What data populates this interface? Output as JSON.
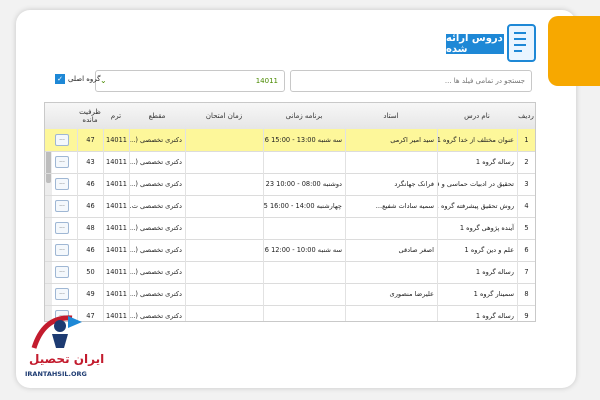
{
  "header": {
    "title": "دروس ارائه شده",
    "icon": "checklist-icon"
  },
  "search": {
    "placeholder": "جستجو در تمامی فیلد ها ..."
  },
  "term_select": {
    "value": "14011"
  },
  "main_group": {
    "label": "گروه اصلی",
    "checked": true
  },
  "table": {
    "headers": {
      "row_no": "ردیف",
      "course": "نام درس",
      "teacher": "استاد",
      "schedule": "برنامه زمانی",
      "exam": "زمان امتحان",
      "level": "مقطع",
      "term": "ترم",
      "capacity": "ظرفیت مانده"
    },
    "rows": [
      {
        "n": "1",
        "course": "عنوان مختلف از خدا گروه 1",
        "teacher": "سید امیر اکرمی",
        "schedule": "سه شنبه 13:00 - 15:00 26 ...",
        "exam": "",
        "level": "دکتری تخصصی (...",
        "term": "14011",
        "capacity": "47",
        "more": "..."
      },
      {
        "n": "2",
        "course": "رساله گروه 1",
        "teacher": "",
        "schedule": "",
        "exam": "",
        "level": "دکتری تخصصی (...",
        "term": "14011",
        "capacity": "43",
        "more": "..."
      },
      {
        "n": "3",
        "course": "تحقیق در ادبیات حماسی و قهرمانی گروه 1",
        "teacher": "فرانک جهانگرد",
        "schedule": "دوشنبه 08:00 - 10:00 23 **",
        "exam": "",
        "level": "دکتری تخصصی (...",
        "term": "14011",
        "capacity": "46",
        "more": "..."
      },
      {
        "n": "4",
        "course": "روش تحقیق پیشرفته گروه 1",
        "teacher": "سمیه سادات شفیع...",
        "schedule": "چهارشنبه 14:00 - 16:00 25 ...",
        "exam": "",
        "level": "دکتری تخصصی ت...",
        "term": "14011",
        "capacity": "46",
        "more": "..."
      },
      {
        "n": "5",
        "course": "آینده پژوهی گروه 1",
        "teacher": "",
        "schedule": "",
        "exam": "",
        "level": "دکتری تخصصی (...",
        "term": "14011",
        "capacity": "48",
        "more": "..."
      },
      {
        "n": "6",
        "course": "علم و دین گروه 1",
        "teacher": "اصغر صادقی",
        "schedule": "سه شنبه 10:00 - 12:00 26 ...",
        "exam": "",
        "level": "دکتری تخصصی (...",
        "term": "14011",
        "capacity": "46",
        "more": "..."
      },
      {
        "n": "7",
        "course": "رساله گروه 1",
        "teacher": "",
        "schedule": "",
        "exam": "",
        "level": "دکتری تخصصی (...",
        "term": "14011",
        "capacity": "50",
        "more": "..."
      },
      {
        "n": "8",
        "course": "سمینار گروه 1",
        "teacher": "علیرضا منصوری",
        "schedule": "",
        "exam": "",
        "level": "دکتری تخصصی (...",
        "term": "14011",
        "capacity": "49",
        "more": "..."
      },
      {
        "n": "9",
        "course": "رساله گروه 1",
        "teacher": "",
        "schedule": "",
        "exam": "",
        "level": "دکتری تخصصی (...",
        "term": "14011",
        "capacity": "47",
        "more": "..."
      }
    ]
  },
  "logo": {
    "name": "ایران تحصیل",
    "url": "IRANTAHSIL.ORG"
  },
  "colors": {
    "accent": "#1e88d6",
    "selected_row": "#fdf79a",
    "orange": "#f7a800",
    "logo_red": "#c31c2e"
  }
}
